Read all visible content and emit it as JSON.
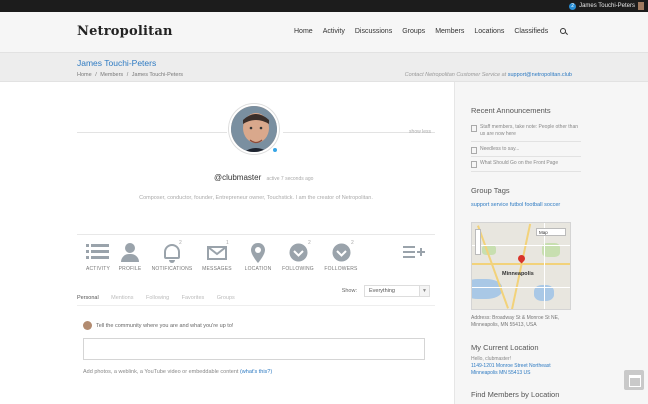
{
  "topbar": {
    "notification_count": "2",
    "user_name": "James Touchi-Peters"
  },
  "header": {
    "logo": "Netropolitan",
    "nav": [
      "Home",
      "Activity",
      "Discussions",
      "Groups",
      "Members",
      "Locations",
      "Classifieds"
    ]
  },
  "titlebar": {
    "title": "James Touchi-Peters",
    "breadcrumb": [
      "Home",
      "/",
      "Members",
      "/",
      "James Touchi-Peters"
    ],
    "contact_text": "Contact Netropolitan Customer Service at",
    "contact_email": "support@netropolitan.club"
  },
  "profile": {
    "show_less": "show less",
    "handle": "@clubmaster",
    "active_time": "active 7 seconds ago",
    "bio": "Composer, conductor, founder, Entrepreneur owner, Touchstick. I am the creator of Netropolitan.",
    "icons": [
      {
        "label": "ACTIVITY",
        "badge": ""
      },
      {
        "label": "PROFILE",
        "badge": ""
      },
      {
        "label": "NOTIFICATIONS",
        "badge": "2"
      },
      {
        "label": "MESSAGES",
        "badge": "1"
      },
      {
        "label": "LOCATION",
        "badge": ""
      },
      {
        "label": "FOLLOWING",
        "badge": "2"
      },
      {
        "label": "FOLLOWERS",
        "badge": "2"
      }
    ],
    "subtabs": [
      "Personal",
      "Mentions",
      "Following",
      "Favorites",
      "Groups"
    ],
    "show_label": "Show:",
    "show_value": "Everything",
    "post_prompt": "Tell the community where you are and what you're up to!",
    "add_media": "Add photos, a weblink, a YouTube video or embeddable content",
    "add_media_link": "(what's this?)"
  },
  "sidebar": {
    "announcements_title": "Recent Announcements",
    "announcements": [
      "Staff members, take note: People other than us are now here",
      "Needless to say...",
      "What Should Go on the Front Page"
    ],
    "tags_title": "Group Tags",
    "tags": "support service futbol football soccer",
    "map_city": "Minneapolis",
    "map_type": "Map",
    "address": "Address: Broadway St & Monroe St NE, Minneapolis, MN 55413, USA",
    "location_title": "My Current Location",
    "location_greeting": "Hello, clubmaster!",
    "location_line1": "1149-1201 Monroe Street Northeast",
    "location_line2": "Minneapolis MN 55413 US",
    "find_title": "Find Members by Location"
  },
  "colors": {
    "accent": "#2d7ac2",
    "online": "#38a6e6"
  }
}
